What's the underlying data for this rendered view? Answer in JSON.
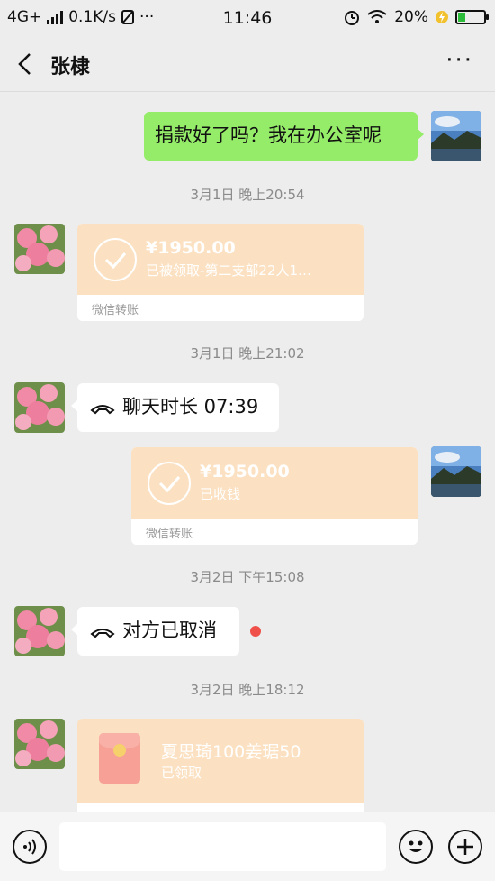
{
  "status_bar": {
    "network": "4G+",
    "speed": "0.1K/s",
    "more": "···",
    "time": "11:46",
    "battery": "20%"
  },
  "header": {
    "title": "张棣",
    "more": "···"
  },
  "messages": {
    "m1_text": "捐款好了吗？我在办公室呢",
    "ts1": "3月1日 晚上20:54",
    "m2": {
      "amount": "¥1950.00",
      "desc": "已被领取-第二支部22人1…",
      "label": "微信转账"
    },
    "ts2": "3月1日 晚上21:02",
    "m3_text": "聊天时长 07:39",
    "m4": {
      "amount": "¥1950.00",
      "desc": "已收钱",
      "label": "微信转账"
    },
    "ts3": "3月2日 下午15:08",
    "m5_text": "对方已取消",
    "ts4": "3月2日 晚上18:12",
    "m6": {
      "title": "夏思琦100姜琚50",
      "status": "已领取"
    }
  },
  "input_bar": {
    "placeholder": ""
  },
  "colors": {
    "background": "#ededed",
    "self_bubble": "#95ec69",
    "transfer_card": "#fbe1c2",
    "unread_dot": "#f0504a"
  }
}
